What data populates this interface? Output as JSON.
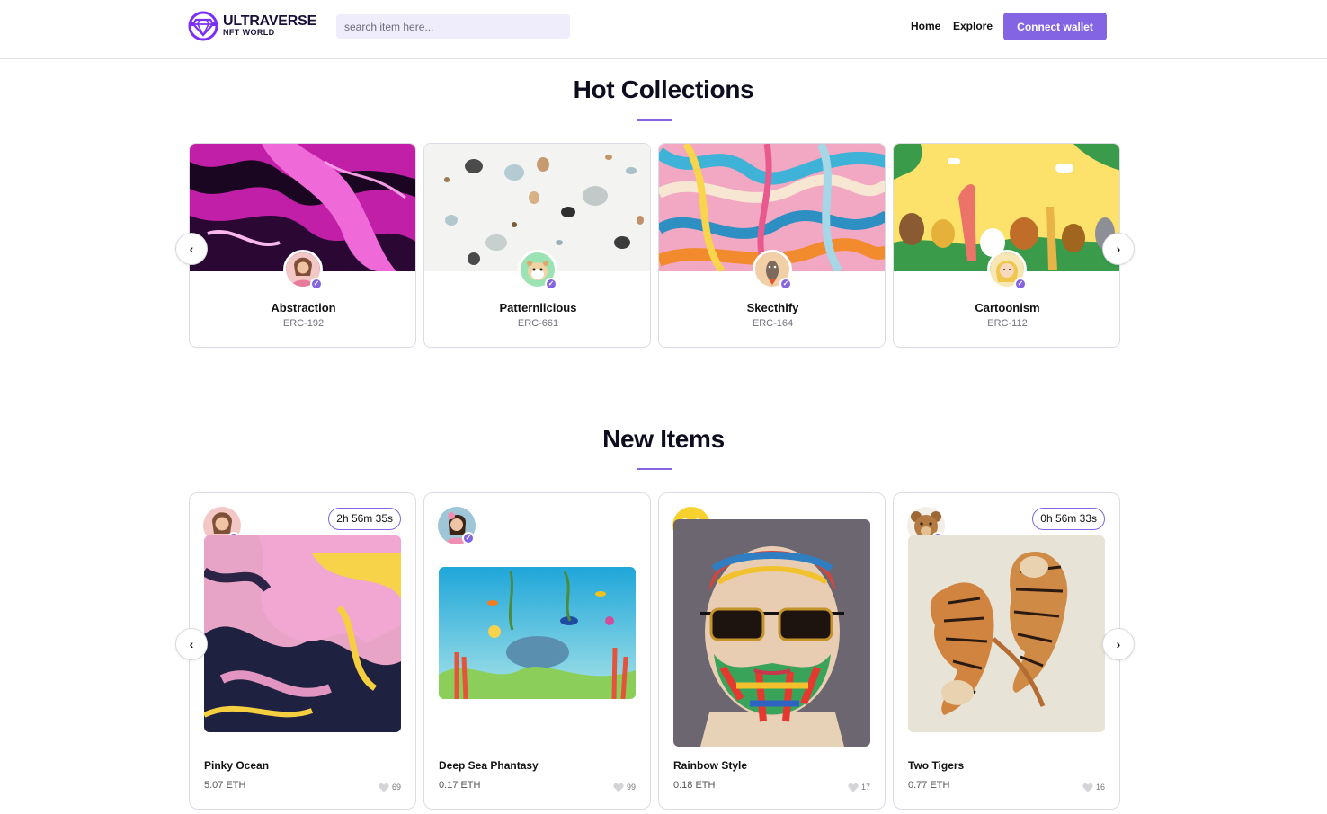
{
  "header": {
    "logo_title": "ULTRAVERSE",
    "logo_subtitle": "NFT WORLD",
    "search_placeholder": "search item here...",
    "nav": {
      "home": "Home",
      "explore": "Explore"
    },
    "connect_label": "Connect wallet"
  },
  "hot_collections": {
    "title": "Hot Collections",
    "prev_label": "‹",
    "next_label": "›",
    "cards": [
      {
        "name": "Abstraction",
        "code": "ERC-192"
      },
      {
        "name": "Patternlicious",
        "code": "ERC-661"
      },
      {
        "name": "Skecthify",
        "code": "ERC-164"
      },
      {
        "name": "Cartoonism",
        "code": "ERC-112"
      }
    ]
  },
  "new_items": {
    "title": "New Items",
    "prev_label": "‹",
    "next_label": "›",
    "cards": [
      {
        "name": "Pinky Ocean",
        "price": "5.07 ETH",
        "likes": "69",
        "countdown": "2h 56m 35s"
      },
      {
        "name": "Deep Sea Phantasy",
        "price": "0.17 ETH",
        "likes": "99",
        "countdown": ""
      },
      {
        "name": "Rainbow Style",
        "price": "0.18 ETH",
        "likes": "17",
        "countdown": ""
      },
      {
        "name": "Two Tigers",
        "price": "0.77 ETH",
        "likes": "16",
        "countdown": "0h 56m 33s"
      }
    ]
  },
  "colors": {
    "accent": "#8364e2",
    "text": "#0d0d1f",
    "search_bg": "#efedfb"
  }
}
